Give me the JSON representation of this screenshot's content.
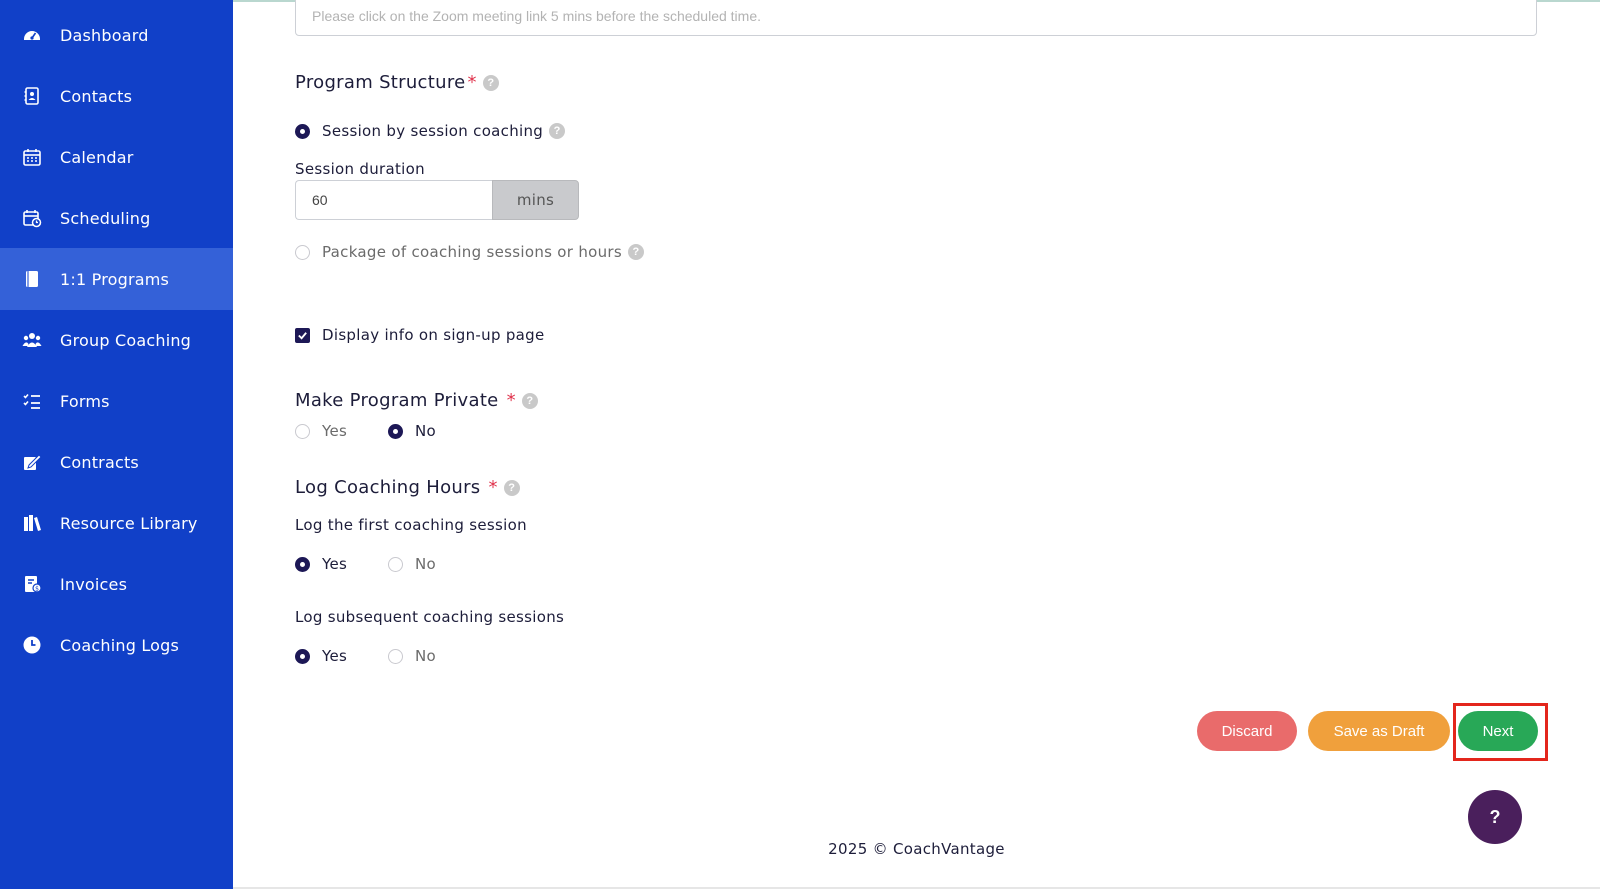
{
  "sidebar": {
    "items": [
      {
        "label": "Dashboard",
        "icon": "dashboard-icon"
      },
      {
        "label": "Contacts",
        "icon": "contacts-icon"
      },
      {
        "label": "Calendar",
        "icon": "calendar-icon"
      },
      {
        "label": "Scheduling",
        "icon": "scheduling-icon"
      },
      {
        "label": "1:1 Programs",
        "icon": "book-icon",
        "active": true
      },
      {
        "label": "Group Coaching",
        "icon": "group-icon"
      },
      {
        "label": "Forms",
        "icon": "forms-icon"
      },
      {
        "label": "Contracts",
        "icon": "contract-icon"
      },
      {
        "label": "Resource Library",
        "icon": "library-icon"
      },
      {
        "label": "Invoices",
        "icon": "invoice-icon"
      },
      {
        "label": "Coaching Logs",
        "icon": "clock-icon"
      }
    ]
  },
  "form": {
    "top_input_placeholder": "Please click on the Zoom meeting link 5 mins before the scheduled time.",
    "program_structure": {
      "title": "Program Structure",
      "required_mark": "*",
      "option_session": "Session by session coaching",
      "session_duration_label": "Session duration",
      "session_duration_value": "60",
      "session_duration_unit": "mins",
      "option_package": "Package of coaching sessions or hours",
      "selected": "session"
    },
    "display_info": {
      "label": "Display info on sign-up page",
      "checked": true
    },
    "private": {
      "title": "Make Program Private",
      "required_mark": "*",
      "yes": "Yes",
      "no": "No",
      "selected": "no"
    },
    "log_hours": {
      "title": "Log Coaching Hours",
      "required_mark": "*",
      "first_label": "Log the first coaching session",
      "first_yes": "Yes",
      "first_no": "No",
      "first_selected": "yes",
      "subsequent_label": "Log subsequent coaching sessions",
      "subsequent_yes": "Yes",
      "subsequent_no": "No",
      "subsequent_selected": "yes"
    }
  },
  "actions": {
    "discard": "Discard",
    "save_draft": "Save as Draft",
    "next": "Next",
    "help": "?"
  },
  "footer": {
    "text": "2025 © CoachVantage"
  },
  "colors": {
    "sidebar": "#1140c8",
    "sidebar_active": "#3461d8",
    "discard": "#e96b6b",
    "draft": "#f0a03c",
    "next": "#28a857",
    "highlight": "#e3261c",
    "radio_checked": "#1d1856",
    "help_fab": "#4a1f5c"
  }
}
